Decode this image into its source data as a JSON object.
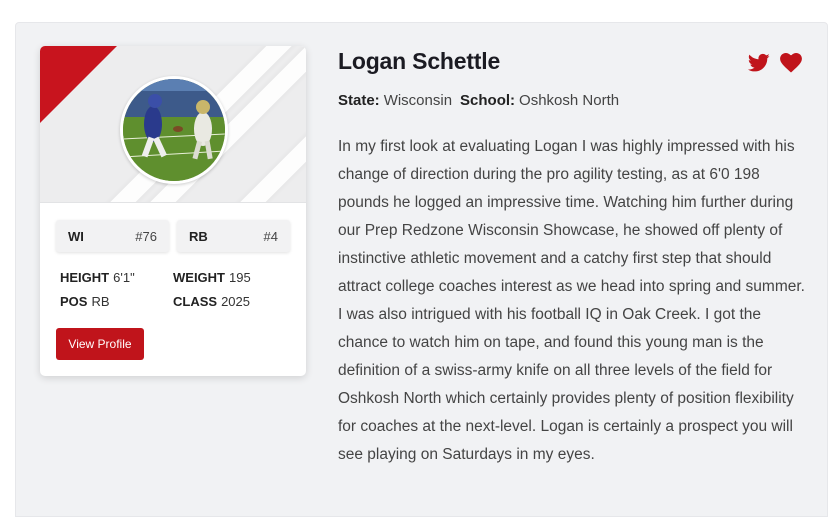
{
  "player": {
    "name": "Logan Schettle",
    "state_label": "State:",
    "state": "Wisconsin",
    "school_label": "School:",
    "school": "Oshkosh North",
    "bio": "In my first look at evaluating Logan I was highly impressed with his change of direction during the pro agility testing, as at 6'0 198 pounds he logged an impressive time. Watching him further during our Prep Redzone Wisconsin Showcase, he showed off plenty of instinctive athletic movement and a catchy first step that should attract college coaches interest as we head into spring and summer. I was also intrigued with his football IQ in Oak Creek. I got the chance to watch him on tape, and found this young man is the definition of a swiss-army knife on all three levels of the field for Oshkosh North which certainly provides plenty of position flexibility for coaches at the next-level. Logan is certainly a  prospect you will see playing on Saturdays in my eyes."
  },
  "card": {
    "badges": [
      {
        "key": "WI",
        "value": "#76"
      },
      {
        "key": "RB",
        "value": "#4"
      }
    ],
    "stats": {
      "height_label": "HEIGHT",
      "height": "6'1\"",
      "weight_label": "WEIGHT",
      "weight": "195",
      "pos_label": "POS",
      "pos": "RB",
      "class_label": "CLASS",
      "class": "2025"
    },
    "view_profile": "View Profile"
  },
  "icons": [
    "twitter-icon",
    "heart-icon"
  ],
  "colors": {
    "accent": "#c0141b",
    "background": "#f1f2f4"
  }
}
